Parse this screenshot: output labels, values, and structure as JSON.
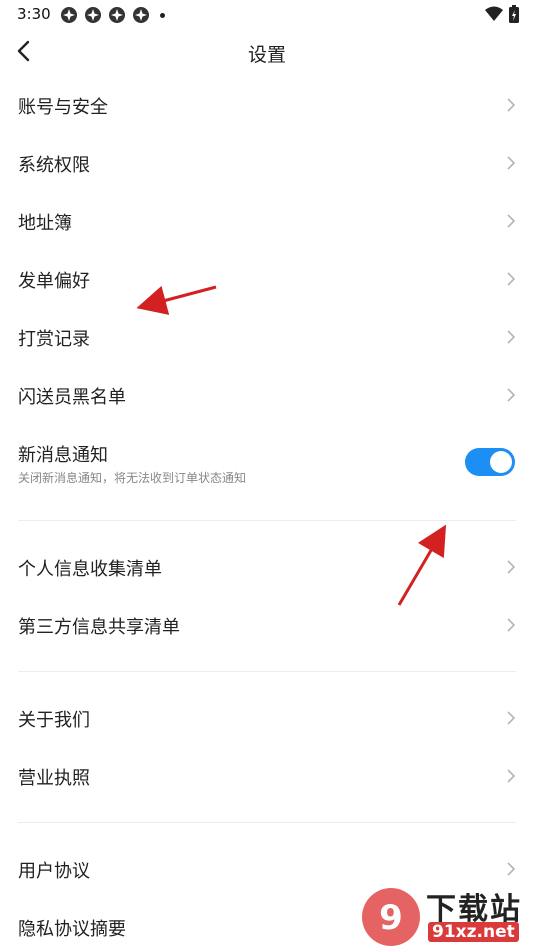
{
  "status_bar": {
    "time": "3:30"
  },
  "header": {
    "title": "设置"
  },
  "items": [
    {
      "label": "账号与安全"
    },
    {
      "label": "系统权限"
    },
    {
      "label": "地址簿"
    },
    {
      "label": "发单偏好"
    },
    {
      "label": "打赏记录"
    },
    {
      "label": "闪送员黑名单"
    }
  ],
  "notification": {
    "label": "新消息通知",
    "description": "关闭新消息通知，将无法收到订单状态通知",
    "enabled": true
  },
  "privacy_items": [
    {
      "label": "个人信息收集清单"
    },
    {
      "label": "第三方信息共享清单"
    }
  ],
  "about_items": [
    {
      "label": "关于我们"
    },
    {
      "label": "营业执照"
    }
  ],
  "legal_items": [
    {
      "label": "用户协议"
    },
    {
      "label": "隐私协议摘要"
    }
  ],
  "watermark": {
    "main": "下载站",
    "url": "91xz.net"
  },
  "colors": {
    "accent": "#1c8ff5",
    "annotation_arrow": "#d32020"
  }
}
